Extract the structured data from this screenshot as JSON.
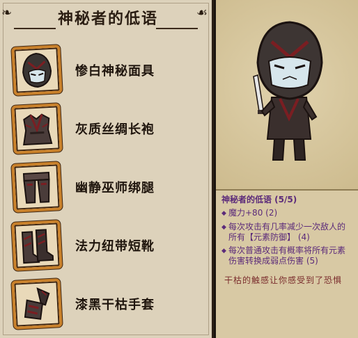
{
  "set_panel": {
    "title": "神秘者的低语",
    "items": [
      {
        "label": "惨白神秘面具",
        "icon": "mask-icon"
      },
      {
        "label": "灰质丝绸长袍",
        "icon": "robe-icon"
      },
      {
        "label": "幽静巫师绑腿",
        "icon": "leggings-icon"
      },
      {
        "label": "法力纽带短靴",
        "icon": "boots-icon"
      },
      {
        "label": "漆黑干枯手套",
        "icon": "gloves-icon"
      }
    ]
  },
  "info_panel": {
    "set_title": "神秘者的低语 (5/5)",
    "bonuses": [
      "魔力+80 (2)",
      "每次攻击有几率减少一次敌人的所有【元素防御】 (4)",
      "每次普通攻击有概率将所有元素伤害转换成弱点伤害 (5)"
    ],
    "flavor": "干枯的触感让你感受到了恐惧"
  },
  "colors": {
    "frame": "#c9812b",
    "set_text": "#5b2a7a",
    "flavor_text": "#7a2c2c",
    "panel_bg": "#ddd2bb"
  }
}
